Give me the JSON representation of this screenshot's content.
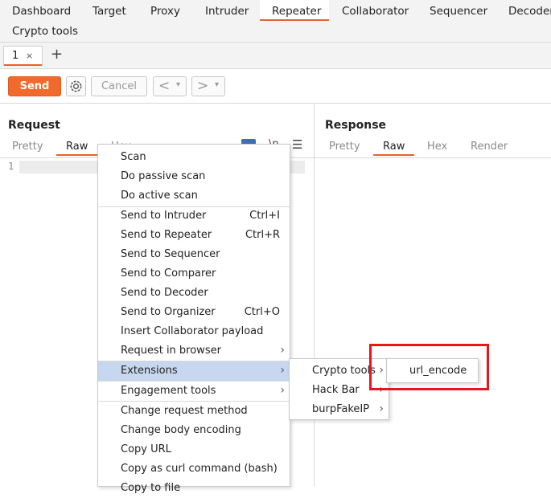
{
  "nav": {
    "tabs": [
      "Dashboard",
      "Target",
      "Proxy",
      "Intruder",
      "Repeater",
      "Collaborator",
      "Sequencer",
      "Decoder"
    ],
    "second_row": "Crypto tools",
    "active": "Repeater"
  },
  "subtabs": {
    "tab1_label": "1",
    "tab1_close": "×",
    "add": "+"
  },
  "toolbar": {
    "send": "Send",
    "cancel": "Cancel",
    "back": "<",
    "forward": ">",
    "dropdown": "▾"
  },
  "request": {
    "title": "Request",
    "tabs": [
      "Pretty",
      "Raw",
      "Hex"
    ],
    "active_tab": "Raw",
    "line_number": "1"
  },
  "response": {
    "title": "Response",
    "tabs": [
      "Pretty",
      "Raw",
      "Hex",
      "Render"
    ],
    "active_tab": "Raw"
  },
  "context_menu": {
    "items": [
      {
        "label": "Scan"
      },
      {
        "label": "Do passive scan"
      },
      {
        "label": "Do active scan"
      },
      {
        "label": "Send to Intruder",
        "shortcut": "Ctrl+I"
      },
      {
        "label": "Send to Repeater",
        "shortcut": "Ctrl+R"
      },
      {
        "label": "Send to Sequencer"
      },
      {
        "label": "Send to Comparer"
      },
      {
        "label": "Send to Decoder"
      },
      {
        "label": "Send to Organizer",
        "shortcut": "Ctrl+O"
      },
      {
        "label": "Insert Collaborator payload"
      },
      {
        "label": "Request in browser",
        "submenu": true
      },
      {
        "label": "Extensions",
        "submenu": true,
        "highlighted": true
      },
      {
        "label": "Engagement tools",
        "submenu": true
      },
      {
        "label": "Change request method"
      },
      {
        "label": "Change body encoding"
      },
      {
        "label": "Copy URL"
      },
      {
        "label": "Copy as curl command (bash)"
      },
      {
        "label": "Copy to file"
      }
    ]
  },
  "extensions_submenu": {
    "items": [
      {
        "label": "Crypto tools",
        "submenu": true
      },
      {
        "label": "Hack Bar",
        "submenu": true
      },
      {
        "label": "burpFakeIP",
        "submenu": true
      }
    ]
  },
  "crypto_submenu": {
    "items": [
      {
        "label": "url_encode"
      }
    ]
  },
  "colors": {
    "accent": "#e8612c",
    "highlight": "#c6d7ef",
    "annotation": "#e8141e"
  }
}
